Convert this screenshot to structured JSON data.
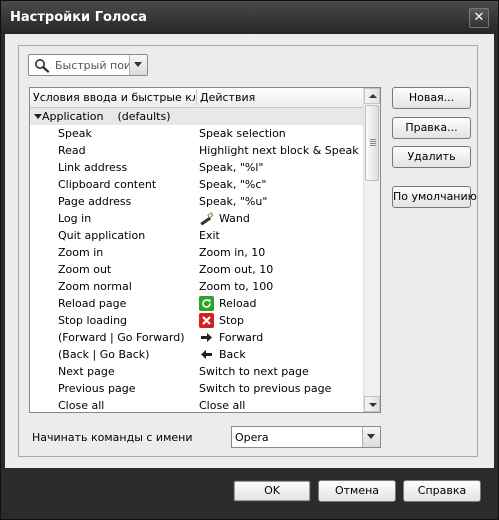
{
  "window": {
    "title": "Настройки Голоса",
    "close_glyph": "✕"
  },
  "search": {
    "placeholder": "Быстрый поиск"
  },
  "table": {
    "headers": [
      "Условия ввода и быстрые кл...",
      "Действия"
    ],
    "group": {
      "label": "Application",
      "sub": "(defaults)"
    },
    "rows": [
      {
        "input": "Speak",
        "action": "Speak selection",
        "icon": ""
      },
      {
        "input": "Read",
        "action": "Highlight next block & Speak...",
        "icon": ""
      },
      {
        "input": "Link address",
        "action": "Speak, \"%l\"",
        "icon": ""
      },
      {
        "input": "Clipboard content",
        "action": "Speak, \"%c\"",
        "icon": ""
      },
      {
        "input": "Page address",
        "action": "Speak, \"%u\"",
        "icon": ""
      },
      {
        "input": "Log in",
        "action": "Wand",
        "icon": "wand-icon"
      },
      {
        "input": "Quit application",
        "action": "Exit",
        "icon": ""
      },
      {
        "input": "Zoom in",
        "action": "Zoom in, 10",
        "icon": ""
      },
      {
        "input": "Zoom out",
        "action": "Zoom out, 10",
        "icon": ""
      },
      {
        "input": "Zoom normal",
        "action": "Zoom to, 100",
        "icon": ""
      },
      {
        "input": "Reload page",
        "action": "Reload",
        "icon": "reload-icon"
      },
      {
        "input": "Stop loading",
        "action": "Stop",
        "icon": "stop-icon"
      },
      {
        "input": "(Forward | Go Forward)",
        "action": "Forward",
        "icon": "forward-arrow-icon"
      },
      {
        "input": "(Back | Go Back)",
        "action": "Back",
        "icon": "back-arrow-icon"
      },
      {
        "input": "Next page",
        "action": "Switch to next page",
        "icon": ""
      },
      {
        "input": "Previous page",
        "action": "Switch to previous page",
        "icon": ""
      },
      {
        "input": "Close all",
        "action": "Close all",
        "icon": ""
      }
    ]
  },
  "side_buttons": {
    "new": "Новая...",
    "edit": "Правка...",
    "delete": "Удалить",
    "defaults": "По умолчанию"
  },
  "start_commands": {
    "label": "Начинать команды с имени",
    "value": "Opera"
  },
  "footer": {
    "ok": "OK",
    "cancel": "Отмена",
    "help": "Справка"
  },
  "colors": {
    "icon_reload": "#2aa52a",
    "icon_stop": "#d42020"
  }
}
